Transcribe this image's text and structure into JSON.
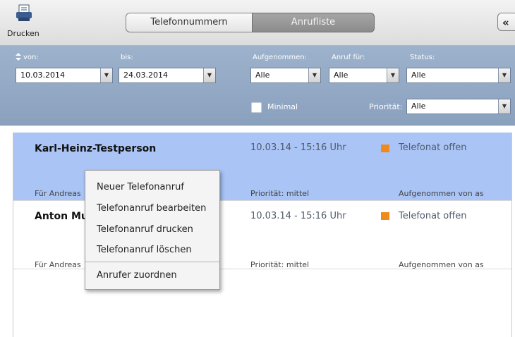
{
  "toolbar": {
    "print_label": "Drucken",
    "tab_phone_numbers": "Telefonnummern",
    "tab_call_list": "Anrufliste",
    "collapse_label": "«"
  },
  "filters": {
    "from_label": "von:",
    "from_value": "10.03.2014",
    "to_label": "bis:",
    "to_value": "24.03.2014",
    "taken_label": "Aufgenommen:",
    "taken_value": "Alle",
    "call_for_label": "Anruf für:",
    "call_for_value": "Alle",
    "status_label": "Status:",
    "status_value": "Alle",
    "minimal_label": "Minimal",
    "priority_label": "Priorität:",
    "priority_value": "Alle"
  },
  "calls": [
    {
      "name": "Karl-Heinz-Testperson",
      "datetime": "10.03.14 - 15:16 Uhr",
      "status": "Telefonat offen",
      "for": "Für Andreas",
      "priority": "Priorität: mittel",
      "taken_by": "Aufgenommen von as",
      "selected": true
    },
    {
      "name": "Anton Mu",
      "datetime": "10.03.14 - 15:16 Uhr",
      "status": "Telefonat offen",
      "for": "Für Andreas",
      "priority": "Priorität: mittel",
      "taken_by": "Aufgenommen von as",
      "selected": false
    }
  ],
  "context_menu": {
    "new_call": "Neuer Telefonanruf",
    "edit_call": "Telefonanruf bearbeiten",
    "print_call": "Telefonanruf drucken",
    "delete_call": "Telefonanruf löschen",
    "assign_caller": "Anrufer zuordnen"
  },
  "colors": {
    "selected_row": "#a9c4f5",
    "filter_panel": "#8fa6c3",
    "status_open": "#f08a1c"
  }
}
